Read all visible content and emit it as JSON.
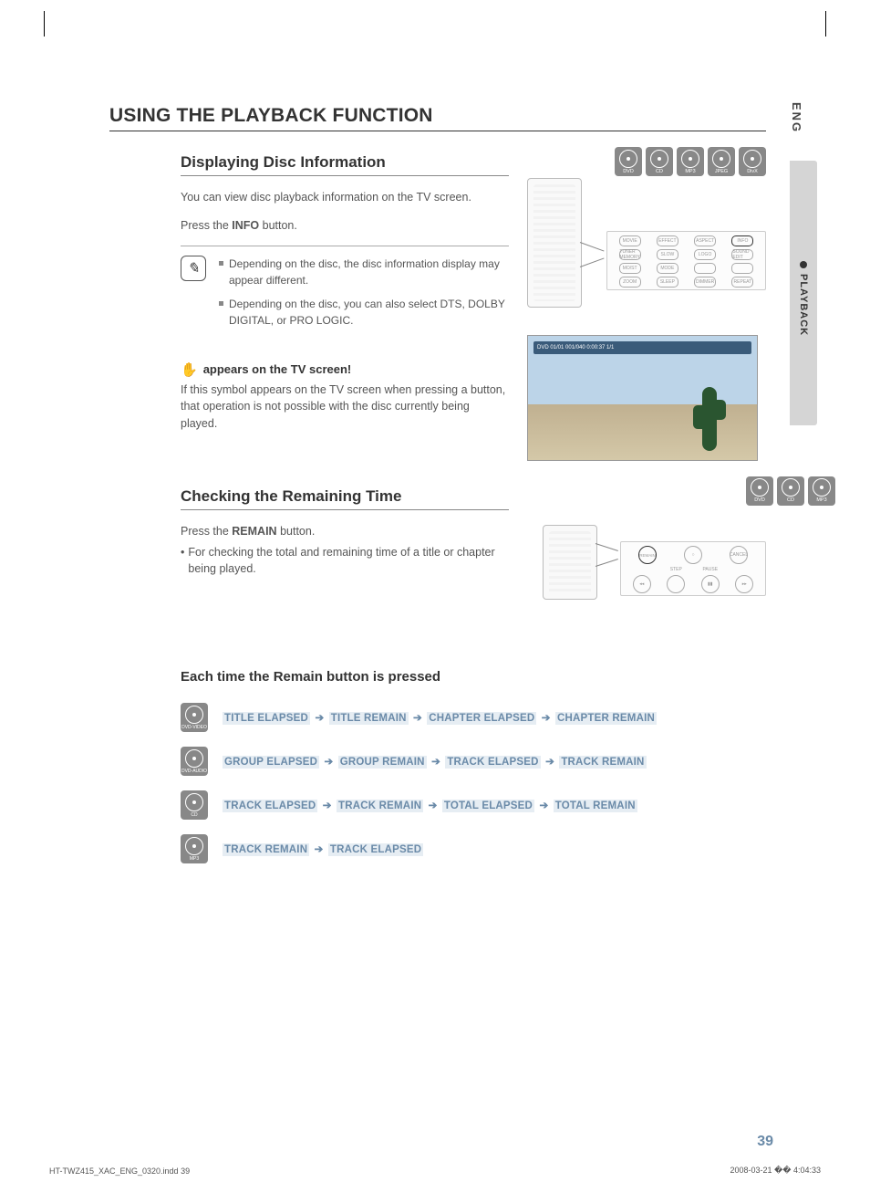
{
  "header": {
    "title": "USING THE PLAYBACK FUNCTION"
  },
  "side": {
    "lang": "ENG",
    "section": "PLAYBACK"
  },
  "section1": {
    "title": "Displaying Disc Information",
    "intro": "You can view disc playback information  on the TV screen.",
    "press": "Press the ",
    "press_btn": "INFO",
    "press_after": " button.",
    "notes": [
      "Depending on the disc, the disc information display may appear different.",
      "Depending on the disc, you can also select DTS, DOLBY DIGITAL, or PRO LOGIC."
    ],
    "hand_title": " appears on the TV screen!",
    "hand_body": "If this symbol appears on the TV screen when pressing a button, that operation is not possible with the disc currently being played.",
    "discs": [
      "DVD",
      "CD",
      "MP3",
      "JPEG",
      "DivX"
    ],
    "remote_buttons": [
      "MOVIE",
      "EFFECT",
      "ASPECT",
      "INFO",
      "TUNER MEMORY",
      "SLOW",
      "LOGO",
      "SOUND EDIT",
      "MO/ST",
      "MODE",
      "",
      "",
      "ZOOM",
      "SLEEP",
      "DIMMER",
      "REPEAT"
    ],
    "osd": "DVD   01/01   001/040   0:00:37   1/1"
  },
  "section2": {
    "title": "Checking the Remaining Time",
    "press": "Press the ",
    "press_btn": "REMAIN",
    "press_after": " button.",
    "bullet": "For checking the total and remaining time of a title or chapter being played.",
    "discs": [
      "DVD",
      "CD",
      "MP3"
    ],
    "remote_row1": [
      "REMAIN",
      "",
      "CANCEL"
    ],
    "remote_labels": [
      "STEP",
      "PAUSE"
    ],
    "remote_row2": [
      "◂◂",
      "",
      "▮▮",
      "▸▸"
    ]
  },
  "section3": {
    "title": "Each time the Remain button is pressed",
    "rows": [
      {
        "label": "DVD-VIDEO",
        "seq": [
          "TITLE ELAPSED",
          "TITLE REMAIN",
          "CHAPTER ELAPSED",
          "CHAPTER REMAIN"
        ]
      },
      {
        "label": "DVD-AUDIO",
        "seq": [
          "GROUP ELAPSED",
          "GROUP REMAIN",
          "TRACK ELAPSED",
          "TRACK REMAIN"
        ]
      },
      {
        "label": "CD",
        "seq": [
          "TRACK ELAPSED",
          "TRACK REMAIN",
          "TOTAL ELAPSED",
          "TOTAL REMAIN"
        ]
      },
      {
        "label": "MP3",
        "seq": [
          "TRACK REMAIN",
          "TRACK ELAPSED"
        ]
      }
    ]
  },
  "page_number": "39",
  "footer": {
    "left": "HT-TWZ415_XAC_ENG_0320.indd   39",
    "right": "2008-03-21   �� 4:04:33"
  }
}
